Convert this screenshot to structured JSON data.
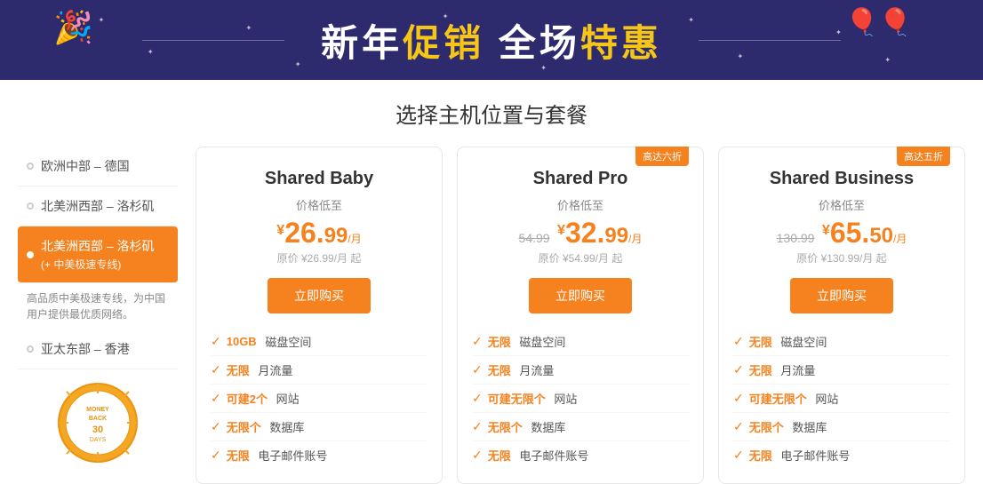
{
  "banner": {
    "text_normal1": "新年",
    "text_highlight1": "促销",
    "text_normal2": "全场",
    "text_highlight2": "特惠",
    "decoration_left": "🎉",
    "decoration_right": "🎈🎈"
  },
  "section_title": "选择主机位置与套餐",
  "sidebar": {
    "items": [
      {
        "id": "europe",
        "label": "欧洲中部 – 德国",
        "active": false
      },
      {
        "id": "us-west",
        "label": "北美洲西部 – 洛杉矶",
        "active": false
      },
      {
        "id": "us-west-cn",
        "label": "北美洲西部 – 洛杉矶\n(+ 中美极速专线)",
        "active": true,
        "sub": "(+ 中美极速专线)"
      },
      {
        "id": "asia",
        "label": "亚太东部 – 香港",
        "active": false
      }
    ],
    "description": "高品质中美极速专线，为中国用户提供最优质网络。",
    "money_back_text": "MONEY BACK"
  },
  "plans": [
    {
      "id": "shared-baby",
      "name": "Shared Baby",
      "badge": null,
      "tagline": "价格低至",
      "price_display": "26.",
      "price_decimal": "99",
      "price_period": "/月",
      "price_old": null,
      "price_original_text": "原价 ¥26.99/月 起",
      "buy_label": "立即购买",
      "features": [
        {
          "highlight": "10GB",
          "text": "磁盘空间"
        },
        {
          "highlight": "无限",
          "text": "月流量"
        },
        {
          "highlight": "可建2个",
          "text": "网站"
        },
        {
          "highlight": "无限个",
          "text": "数据库"
        },
        {
          "highlight": "无限",
          "text": "电子邮件账号"
        }
      ]
    },
    {
      "id": "shared-pro",
      "name": "Shared Pro",
      "badge": "高达六折",
      "tagline": "价格低至",
      "price_old": "54.99",
      "price_display": "32.",
      "price_decimal": "99",
      "price_period": "/月",
      "price_original_text": "原价 ¥54.99/月 起",
      "buy_label": "立即购买",
      "features": [
        {
          "highlight": "无限",
          "text": "磁盘空间"
        },
        {
          "highlight": "无限",
          "text": "月流量"
        },
        {
          "highlight": "可建无限个",
          "text": "网站"
        },
        {
          "highlight": "无限个",
          "text": "数据库"
        },
        {
          "highlight": "无限",
          "text": "电子邮件账号"
        }
      ]
    },
    {
      "id": "shared-business",
      "name": "Shared Business",
      "badge": "高达五折",
      "tagline": "价格低至",
      "price_old": "130.99",
      "price_display": "65.",
      "price_decimal": "50",
      "price_period": "/月",
      "price_original_text": "原价 ¥130.99/月 起",
      "buy_label": "立即购买",
      "features": [
        {
          "highlight": "无限",
          "text": "磁盘空间"
        },
        {
          "highlight": "无限",
          "text": "月流量"
        },
        {
          "highlight": "可建无限个",
          "text": "网站"
        },
        {
          "highlight": "无限个",
          "text": "数据库"
        },
        {
          "highlight": "无限",
          "text": "电子邮件账号"
        }
      ]
    }
  ]
}
